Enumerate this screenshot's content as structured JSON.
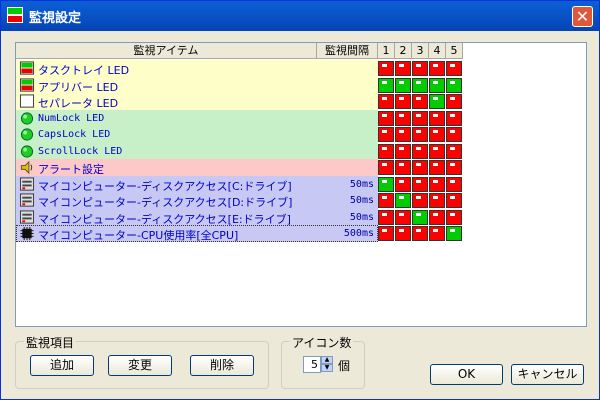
{
  "window": {
    "title": "監視設定",
    "close_symbol": "✕"
  },
  "list": {
    "columns": {
      "item": "監視アイテム",
      "interval": "監視間隔",
      "slots": [
        "1",
        "2",
        "3",
        "4",
        "5"
      ]
    },
    "rows": [
      {
        "label": "タスクトレイ LED",
        "interval": "",
        "bg": "#fefec8",
        "icon": "led-tray-icon",
        "mono": false,
        "flags": [
          "r",
          "r",
          "r",
          "r",
          "r"
        ]
      },
      {
        "label": "アプリバー LED",
        "interval": "",
        "bg": "#fefec8",
        "icon": "led-bar-icon",
        "mono": false,
        "flags": [
          "g",
          "g",
          "g",
          "g",
          "g"
        ]
      },
      {
        "label": "セパレータ LED",
        "interval": "",
        "bg": "#fefec8",
        "icon": "blank-icon",
        "mono": false,
        "flags": [
          "r",
          "r",
          "r",
          "g",
          "r"
        ]
      },
      {
        "label": "NumLock LED",
        "interval": "",
        "bg": "#c8f0c8",
        "icon": "green-circle-icon",
        "mono": true,
        "flags": [
          "r",
          "r",
          "r",
          "r",
          "r"
        ]
      },
      {
        "label": "CapsLock LED",
        "interval": "",
        "bg": "#c8f0c8",
        "icon": "green-circle-icon",
        "mono": true,
        "flags": [
          "r",
          "r",
          "r",
          "r",
          "r"
        ]
      },
      {
        "label": "ScrollLock LED",
        "interval": "",
        "bg": "#c8f0c8",
        "icon": "green-circle-icon",
        "mono": true,
        "flags": [
          "r",
          "r",
          "r",
          "r",
          "r"
        ]
      },
      {
        "label": "アラート設定",
        "interval": "",
        "bg": "#fcc8c8",
        "icon": "speaker-icon",
        "mono": false,
        "flags": [
          "r",
          "r",
          "r",
          "r",
          "r"
        ]
      },
      {
        "label": "マイコンピューター-ディスクアクセス[C:ドライブ]",
        "interval": "50ms",
        "bg": "#c8c8f4",
        "icon": "disk-icon",
        "mono": false,
        "flags": [
          "g",
          "r",
          "r",
          "r",
          "r"
        ]
      },
      {
        "label": "マイコンピューター-ディスクアクセス[D:ドライブ]",
        "interval": "50ms",
        "bg": "#c8c8f4",
        "icon": "disk-icon",
        "mono": false,
        "flags": [
          "r",
          "g",
          "r",
          "r",
          "r"
        ]
      },
      {
        "label": "マイコンピューター-ディスクアクセス[E:ドライブ]",
        "interval": "50ms",
        "bg": "#c8c8f4",
        "icon": "disk-icon",
        "mono": false,
        "flags": [
          "r",
          "r",
          "g",
          "r",
          "r"
        ]
      },
      {
        "label": "マイコンピューター-CPU使用率[全CPU]",
        "interval": "500ms",
        "bg": "#c8c8f4",
        "icon": "cpu-icon",
        "mono": false,
        "flags": [
          "r",
          "r",
          "r",
          "r",
          "g"
        ]
      }
    ]
  },
  "monitor_group": {
    "legend": "監視項目",
    "add": "追加",
    "change": "変更",
    "delete": "削除"
  },
  "icon_group": {
    "legend": "アイコン数",
    "value": "5",
    "unit": "個"
  },
  "buttons": {
    "ok": "OK",
    "cancel": "キャンセル"
  },
  "colors": {
    "flag_on": "#00cc00",
    "flag_off": "#ff0000",
    "title_bar": "#0953c6"
  }
}
